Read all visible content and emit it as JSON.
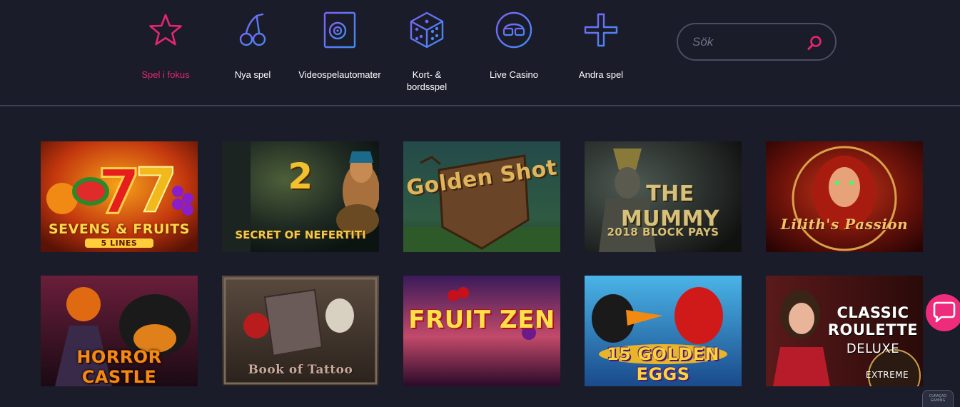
{
  "nav": {
    "items": [
      {
        "label": "Spel i fokus",
        "icon": "star-icon",
        "active": true
      },
      {
        "label": "Nya spel",
        "icon": "cherries-icon"
      },
      {
        "label": "Videospelautomater",
        "icon": "slot-reel-icon"
      },
      {
        "label": "Kort- &\nbordsspel",
        "icon": "dice-icon"
      },
      {
        "label": "Live Casino",
        "icon": "dealer-icon"
      },
      {
        "label": "Andra spel",
        "icon": "plus-icon"
      }
    ]
  },
  "search": {
    "placeholder": "Sök",
    "value": ""
  },
  "colors": {
    "background": "#1b1c2a",
    "accent_pink": "#e6266f",
    "icon_purple": "#6a5cf0",
    "divider": "#3c3f55"
  },
  "games": [
    {
      "title": "SEVENS & FRUITS",
      "subtitle": "5 LINES"
    },
    {
      "title": "SECRET OF NEFERTITI",
      "subtitle": "2"
    },
    {
      "title": "Golden Shot",
      "subtitle": ""
    },
    {
      "title": "THE MUMMY",
      "subtitle": "2018 BLOCK PAYS"
    },
    {
      "title": "Lilith's Passion",
      "subtitle": ""
    },
    {
      "title": "HORROR CASTLE",
      "subtitle": ""
    },
    {
      "title": "Book of Tattoo",
      "subtitle": ""
    },
    {
      "title": "FRUIT ZEN",
      "subtitle": ""
    },
    {
      "title": "15 GOLDEN EGGS",
      "subtitle": ""
    },
    {
      "title": "CLASSIC ROULETTE",
      "subtitle": "DELUXE",
      "extra": "EXTREME"
    }
  ],
  "chat": {
    "icon": "chat-bubble-icon"
  },
  "seal": {
    "text": "CURAÇAO GAMING"
  }
}
